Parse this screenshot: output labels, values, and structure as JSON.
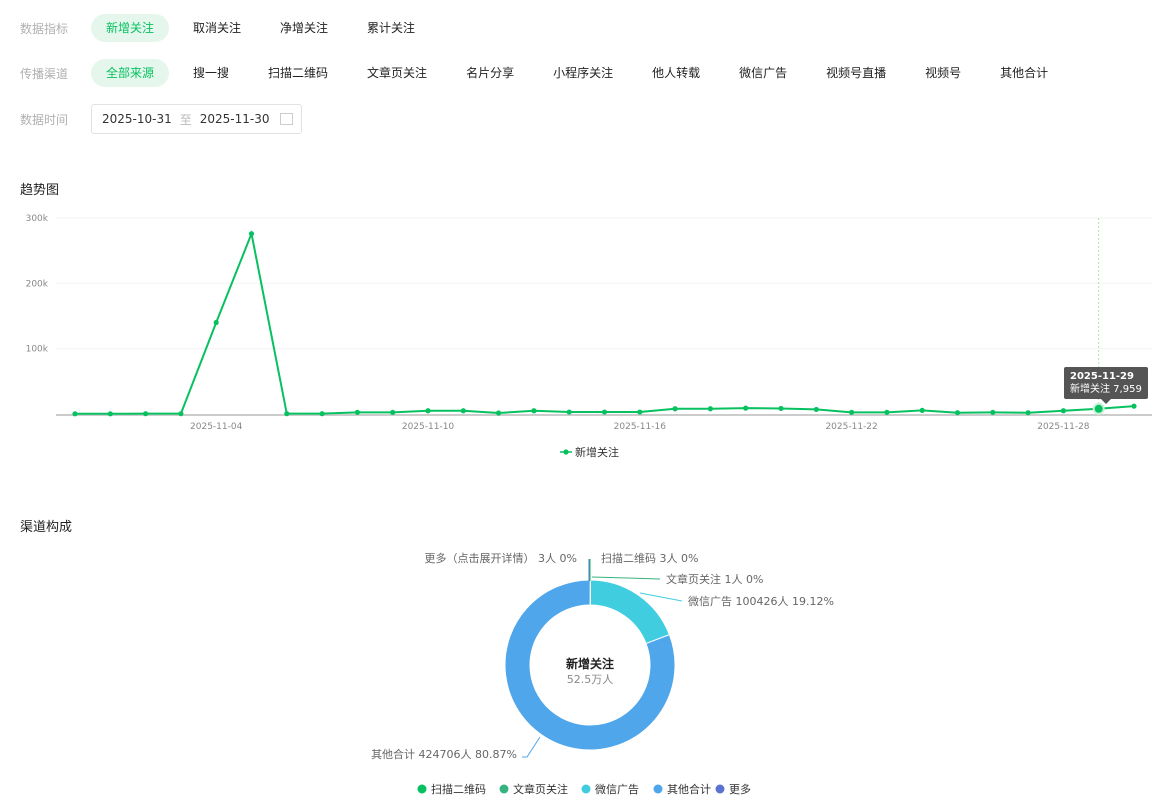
{
  "filters": {
    "metric": {
      "label": "数据指标",
      "options": [
        "新增关注",
        "取消关注",
        "净增关注",
        "累计关注"
      ],
      "selected": 0
    },
    "channel": {
      "label": "传播渠道",
      "options": [
        "全部来源",
        "搜一搜",
        "扫描二维码",
        "文章页关注",
        "名片分享",
        "小程序关注",
        "他人转载",
        "微信广告",
        "视频号直播",
        "视频号",
        "其他合计"
      ],
      "selected": 0
    },
    "date": {
      "label": "数据时间",
      "start": "2025-10-31",
      "to": "至",
      "end": "2025-11-30"
    }
  },
  "trend": {
    "title": "趋势图"
  },
  "channels": {
    "title": "渠道构成"
  },
  "chart_data": [
    {
      "type": "line",
      "title": "趋势图",
      "series_name": "新增关注",
      "color": "#07c160",
      "x": [
        "2025-10-31",
        "2025-11-01",
        "2025-11-02",
        "2025-11-03",
        "2025-11-04",
        "2025-11-05",
        "2025-11-06",
        "2025-11-07",
        "2025-11-08",
        "2025-11-09",
        "2025-11-10",
        "2025-11-11",
        "2025-11-12",
        "2025-11-13",
        "2025-11-14",
        "2025-11-15",
        "2025-11-16",
        "2025-11-17",
        "2025-11-18",
        "2025-11-19",
        "2025-11-20",
        "2025-11-21",
        "2025-11-22",
        "2025-11-23",
        "2025-11-24",
        "2025-11-25",
        "2025-11-26",
        "2025-11-27",
        "2025-11-28",
        "2025-11-29",
        "2025-11-30"
      ],
      "values": [
        300,
        300,
        500,
        500,
        140000,
        276000,
        500,
        500,
        2500,
        2500,
        5000,
        5000,
        1500,
        5000,
        3000,
        3000,
        3000,
        8000,
        8000,
        9000,
        8500,
        7000,
        2500,
        2500,
        5500,
        2000,
        2500,
        2000,
        5000,
        7959,
        12000
      ],
      "x_ticks": [
        "2025-11-04",
        "2025-11-10",
        "2025-11-16",
        "2025-11-22",
        "2025-11-28"
      ],
      "y_ticks": [
        "100k",
        "200k",
        "300k"
      ],
      "ylim": [
        0,
        300000
      ],
      "legend": "bottom",
      "tooltip": {
        "date": "2025-11-29",
        "label": "新增关注 7,959",
        "index": 29
      }
    },
    {
      "type": "pie",
      "title": "渠道构成",
      "center_title": "新增关注",
      "center_value": "52.5万人",
      "slices": [
        {
          "name": "扫描二维码",
          "value": 3,
          "label": "扫描二维码 3人 0%",
          "color": "#07c160"
        },
        {
          "name": "文章页关注",
          "value": 1,
          "label": "文章页关注 1人 0%",
          "color": "#36b37e"
        },
        {
          "name": "微信广告",
          "value": 100426,
          "label": "微信广告 100426人 19.12%",
          "color": "#40cde0"
        },
        {
          "name": "其他合计",
          "value": 424706,
          "label": "其他合计 424706人 80.87%",
          "color": "#4fa6ea"
        },
        {
          "name": "更多",
          "value": 3,
          "label": "更多（点击展开详情） 3人 0%",
          "color": "#5b72d1"
        }
      ],
      "legend": "bottom"
    }
  ]
}
